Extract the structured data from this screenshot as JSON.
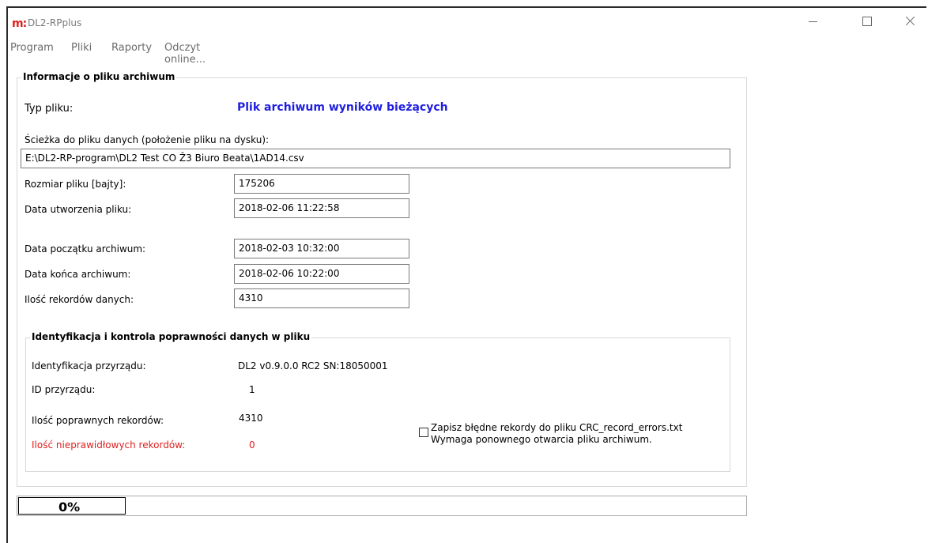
{
  "window": {
    "title": "DL2-RPplus",
    "app_icon_glyph": "m:"
  },
  "menu": {
    "items": [
      "Program",
      "Pliki",
      "Raporty",
      "Odczyt online..."
    ]
  },
  "archive_info": {
    "group_title": "Informacje o pliku archiwum",
    "file_type_label": "Typ pliku:",
    "file_type_value": "Plik archiwum wyników bieżących",
    "path_label": "Ścieżka do pliku danych (położenie pliku na dysku):",
    "path_value": "E:\\DL2-RP-program\\DL2 Test CO Ž3 Biuro Beata\\1AD14.csv",
    "size_label": "Rozmiar pliku [bajty]:",
    "size_value": "175206",
    "created_label": "Data utworzenia pliku:",
    "created_value": "2018-02-06 11:22:58",
    "start_label": "Data początku archiwum:",
    "start_value": "2018-02-03 10:32:00",
    "end_label": "Data końca archiwum:",
    "end_value": "2018-02-06 10:22:00",
    "records_label": "Ilość rekordów danych:",
    "records_value": "4310"
  },
  "validation": {
    "group_title": "Identyfikacja i kontrola poprawności danych w pliku",
    "device_id_label": "Identyfikacja przyrządu:",
    "device_id_value": "DL2 v0.9.0.0 RC2  SN:18050001",
    "id_label": "ID przyrządu:",
    "id_value": "1",
    "valid_label": "Ilość poprawnych rekordów:",
    "valid_value": "4310",
    "invalid_label": "Ilość nieprawidłowych rekordów:",
    "invalid_value": "0",
    "save_errors_line1": "Zapisz błędne rekordy do pliku CRC_record_errors.txt",
    "save_errors_line2": "Wymaga ponownego otwarcia pliku archiwum.",
    "save_errors_checked": false
  },
  "progress": {
    "text": "0%",
    "value": 0
  },
  "colors": {
    "file_type_value": "#1f1fe0",
    "invalid_text": "#e02020",
    "app_icon": "#e02020",
    "menu_text": "#6b6b6b"
  }
}
